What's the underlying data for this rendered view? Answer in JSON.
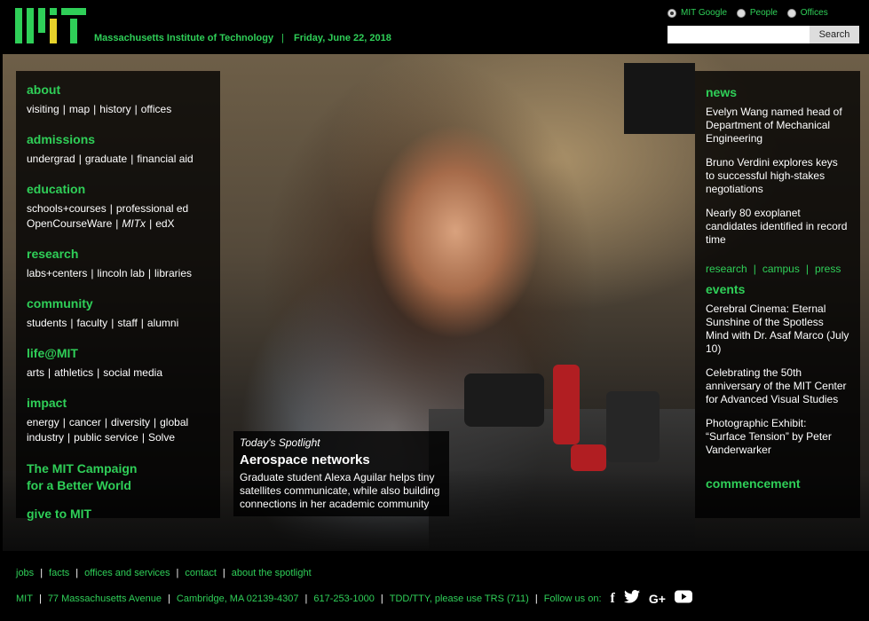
{
  "header": {
    "institution": "Massachusetts Institute of Technology",
    "separator": "|",
    "date": "Friday, June 22, 2018",
    "search_options": [
      {
        "label": "MIT Google",
        "selected": true
      },
      {
        "label": "People",
        "selected": false
      },
      {
        "label": "Offices",
        "selected": false
      }
    ],
    "search_placeholder": "",
    "search_button": "Search"
  },
  "nav": {
    "about": {
      "title": "about",
      "links": [
        "visiting",
        "map",
        "history",
        "offices"
      ]
    },
    "admissions": {
      "title": "admissions",
      "links": [
        "undergrad",
        "graduate",
        "financial aid"
      ]
    },
    "education": {
      "title": "education",
      "links_line1": [
        "schools+courses",
        "professional ed"
      ],
      "links_line2": [
        "OpenCourseWare",
        "MITx",
        "edX"
      ]
    },
    "research": {
      "title": "research",
      "links": [
        "labs+centers",
        "lincoln lab",
        "libraries"
      ]
    },
    "community": {
      "title": "community",
      "links": [
        "students",
        "faculty",
        "staff",
        "alumni"
      ]
    },
    "life": {
      "title": "life@MIT",
      "links": [
        "arts",
        "athletics",
        "social media"
      ]
    },
    "impact": {
      "title": "impact",
      "links_line1": [
        "energy",
        "cancer",
        "diversity",
        "global"
      ],
      "links_line2": [
        "industry",
        "public service",
        "Solve"
      ]
    },
    "campaign_line1": "The MIT Campaign",
    "campaign_line2": "for a Better World",
    "give": "give to MIT"
  },
  "spotlight": {
    "label": "Today's Spotlight",
    "title": "Aerospace networks",
    "description": "Graduate student Alexa Aguilar helps tiny satellites communicate, while also building connections in her academic community"
  },
  "right": {
    "news_title": "news",
    "news": [
      "Evelyn Wang named head of Department of Mechanical Engineering",
      "Bruno Verdini explores keys to successful high-stakes negotiations",
      "Nearly 80 exoplanet candidates identified in record time"
    ],
    "news_links": [
      "research",
      "campus",
      "press"
    ],
    "news_links_sep": "|",
    "events_title": "events",
    "events": [
      "Cerebral Cinema: Eternal Sunshine of the Spotless Mind with Dr. Asaf Marco (July 10)",
      "Celebrating the 50th anniversary of the MIT Center for Advanced Visual Studies",
      "Photographic Exhibit: “Surface Tension” by Peter Vanderwarker"
    ],
    "commencement": "commencement"
  },
  "footer": {
    "row1": [
      "jobs",
      "facts",
      "offices and services",
      "contact",
      "about the spotlight"
    ],
    "row2": [
      "MIT",
      "77 Massachusetts Avenue",
      "Cambridge, MA 02139-4307",
      "617-253-1000",
      "TDD/TTY, please use TRS (711)"
    ],
    "follow": "Follow us on:",
    "social": [
      {
        "icon": "facebook-icon",
        "glyph": "f"
      },
      {
        "icon": "twitter-icon",
        "glyph": "🐦"
      },
      {
        "icon": "google-plus-icon",
        "glyph": "G+"
      },
      {
        "icon": "youtube-icon",
        "glyph": "▶"
      }
    ],
    "separator": "|"
  },
  "colors": {
    "accent_green": "#2fcf58",
    "logo_gray": "#8a8b8c",
    "logo_yellow": "#e6d22a",
    "background": "#000000"
  }
}
